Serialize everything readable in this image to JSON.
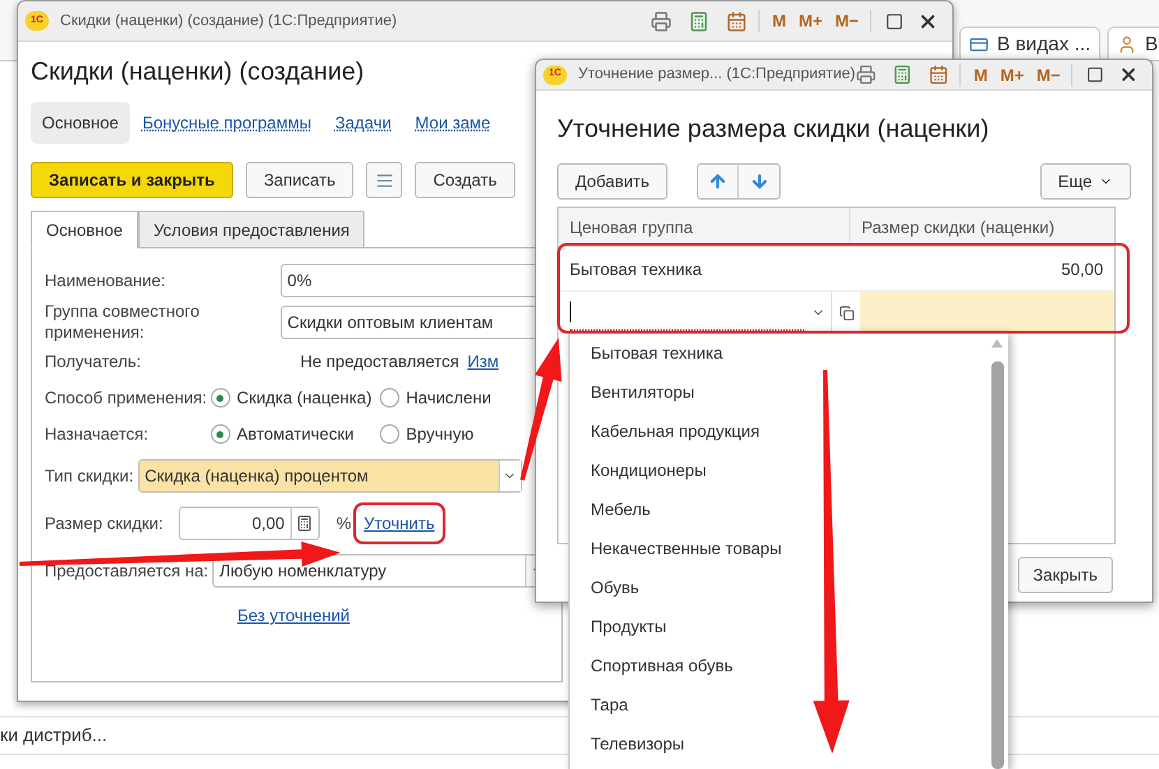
{
  "background": {
    "tabs": [
      "В видах ...",
      "В"
    ],
    "list_row": "ки дистриб..."
  },
  "main_window": {
    "logo": "1С",
    "title": "Скидки (наценки) (создание)  (1С:Предприятие)",
    "memory_buttons": [
      "M",
      "M+",
      "M−"
    ],
    "heading": "Скидки (наценки) (создание)",
    "nav": [
      {
        "label": "Основное",
        "selected": true
      },
      {
        "label": "Бонусные программы",
        "selected": false
      },
      {
        "label": "Задачи",
        "selected": false
      },
      {
        "label": "Мои заме",
        "selected": false
      }
    ],
    "toolbar": [
      {
        "kind": "primary",
        "label": "Записать и закрыть"
      },
      {
        "kind": "default",
        "label": "Записать"
      },
      {
        "kind": "icon"
      },
      {
        "kind": "default",
        "label": "Создать"
      }
    ],
    "tabs": [
      {
        "label": "Основное",
        "selected": true
      },
      {
        "label": "Условия предоставления",
        "selected": false
      }
    ],
    "fields": [
      {
        "kind": "text",
        "label": "Наименование:",
        "value": "0%"
      },
      {
        "kind": "text",
        "label": "Группа совместного применения:",
        "value": "Скидки оптовым клиентам"
      },
      {
        "kind": "info",
        "label": "Получатель:",
        "value": "Не предоставляется",
        "link": "Изм"
      },
      {
        "kind": "radio",
        "label": "Способ применения:",
        "options": [
          {
            "label": "Скидка (наценка)",
            "selected": true
          },
          {
            "label": "Начислени",
            "selected": false
          }
        ]
      },
      {
        "kind": "radio",
        "label": "Назначается:",
        "options": [
          {
            "label": "Автоматически",
            "selected": true
          },
          {
            "label": "Вручную",
            "selected": false
          }
        ]
      },
      {
        "kind": "select",
        "label": "Тип скидки:",
        "value": "Скидка (наценка) процентом",
        "highlighted": true
      },
      {
        "kind": "number",
        "label": "Размер скидки:",
        "value": "0,00",
        "unit": "%",
        "link": "Уточнить"
      },
      {
        "kind": "select",
        "label": "Предоставляется на:",
        "value": "Любую номенклатуру",
        "highlighted": false
      },
      {
        "kind": "link",
        "label": "Без уточнений"
      }
    ]
  },
  "dialog": {
    "logo": "1С",
    "title": "Уточнение размер...  (1С:Предприятие)",
    "memory_buttons": [
      "M",
      "M+",
      "M−"
    ],
    "heading": "Уточнение размера скидки (наценки)",
    "add_button": "Добавить",
    "more_button": "Еще",
    "columns": [
      "Ценовая группа",
      "Размер скидки (наценки)"
    ],
    "rows": [
      {
        "kind": "value",
        "group": "Бытовая техника",
        "amount": "50,00"
      },
      {
        "kind": "edit"
      }
    ],
    "close_button": "Закрыть"
  },
  "dropdown": {
    "items": [
      "Бытовая техника",
      "Вентиляторы",
      "Кабельная продукция",
      "Кондиционеры",
      "Мебель",
      "Некачественные товары",
      "Обувь",
      "Продукты",
      "Спортивная обувь",
      "Тара",
      "Телевизоры"
    ]
  }
}
